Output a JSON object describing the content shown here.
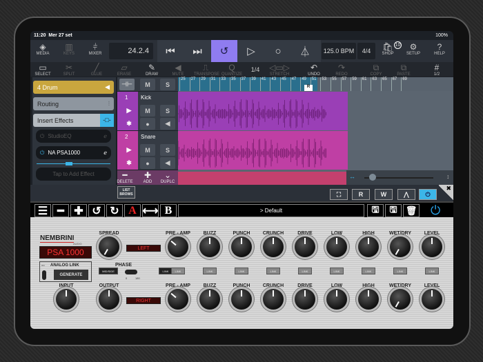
{
  "status": {
    "time": "11:20",
    "date": "Mer 27 set",
    "battery": "100%"
  },
  "toolbar": {
    "media": "MEDIA",
    "keys": "KEYS",
    "mixer": "MIXER",
    "position": "24.2.4",
    "bpm": "125.0 BPM",
    "signature": "4/4",
    "shop": "SHOP",
    "shop_badge": "10",
    "setup": "SETUP",
    "help": "HELP",
    "loop_color": "#8f7cf0"
  },
  "tools": [
    {
      "label": "SELECT",
      "icon": "▭",
      "on": true
    },
    {
      "label": "SPLIT",
      "icon": "✂",
      "on": false
    },
    {
      "label": "GLUE",
      "icon": "╱",
      "on": false
    },
    {
      "label": "ERASE",
      "icon": "▱",
      "on": false
    },
    {
      "label": "DRAW",
      "icon": "✎",
      "on": true
    },
    {
      "label": "MUTE",
      "icon": "◀",
      "on": false
    },
    {
      "label": "TRANSPOSE",
      "icon": "⎍",
      "on": false
    },
    {
      "label": "QUANTIZE",
      "icon": "Q",
      "on": false
    },
    {
      "label": "1/4",
      "icon": "",
      "on": true
    },
    {
      "label": "STRETCH",
      "icon": "◁▭▷",
      "on": false
    },
    {
      "label": "UNDO",
      "icon": "↶",
      "on": true
    },
    {
      "label": "REDO",
      "icon": "↷",
      "on": false
    },
    {
      "label": "COPY",
      "icon": "⧉",
      "on": false
    },
    {
      "label": "PASTE",
      "icon": "⧉",
      "on": false
    },
    {
      "label": "1/2",
      "icon": "#",
      "on": true
    }
  ],
  "panel": {
    "track": "4  Drum",
    "routing": "Routing",
    "insert": "Insert Effects",
    "effects": [
      {
        "name": "StudioEQ",
        "active": false
      },
      {
        "name": "NA PSA1000",
        "active": true
      }
    ],
    "add_effect": "Tap to Add Effect"
  },
  "tracks": [
    {
      "num": "1",
      "name": "Kick",
      "color": "#9a3fb6"
    },
    {
      "num": "2",
      "name": "Snare",
      "color": "#bf3fa4"
    }
  ],
  "track_actions": {
    "delete": "DELETE",
    "add": "ADD",
    "duplicate": "DUPLC"
  },
  "ruler": {
    "bars": [
      "25",
      "27",
      "29",
      "31",
      "33",
      "35",
      "37",
      "39",
      "41",
      "43",
      "45",
      "47",
      "49",
      "51",
      "53",
      "55",
      "57",
      "59",
      "61",
      "63",
      "65",
      "67",
      "69"
    ],
    "marker": "R"
  },
  "bottom": {
    "list": "LIST",
    "brows": "BROWS",
    "read": "R",
    "write": "W"
  },
  "plugin": {
    "preset": "> Default",
    "brand": "NEMBRINI",
    "brand_sub": "AUDIO",
    "model": "PSA 1000",
    "analog_link": "ANALOG LINK",
    "on": "ON",
    "generate": "GENERATE",
    "spread": "SPREAD",
    "input": "INPUT",
    "output": "OUTPUT",
    "left": "LEFT",
    "right": "RIGHT",
    "midside": "MID/SIDE",
    "phase": "PHASE",
    "phase_0": "0",
    "phase_180": "180",
    "link": "LINK",
    "a": "A",
    "b": "B",
    "knobs": [
      "PRE - AMP",
      "BUZZ",
      "PUNCH",
      "CRUNCH",
      "DRIVE",
      "LOW",
      "HIGH",
      "WET/DRY",
      "LEVEL"
    ],
    "knob_angles": [
      -50,
      0,
      0,
      0,
      0,
      0,
      0,
      -150,
      0
    ]
  }
}
